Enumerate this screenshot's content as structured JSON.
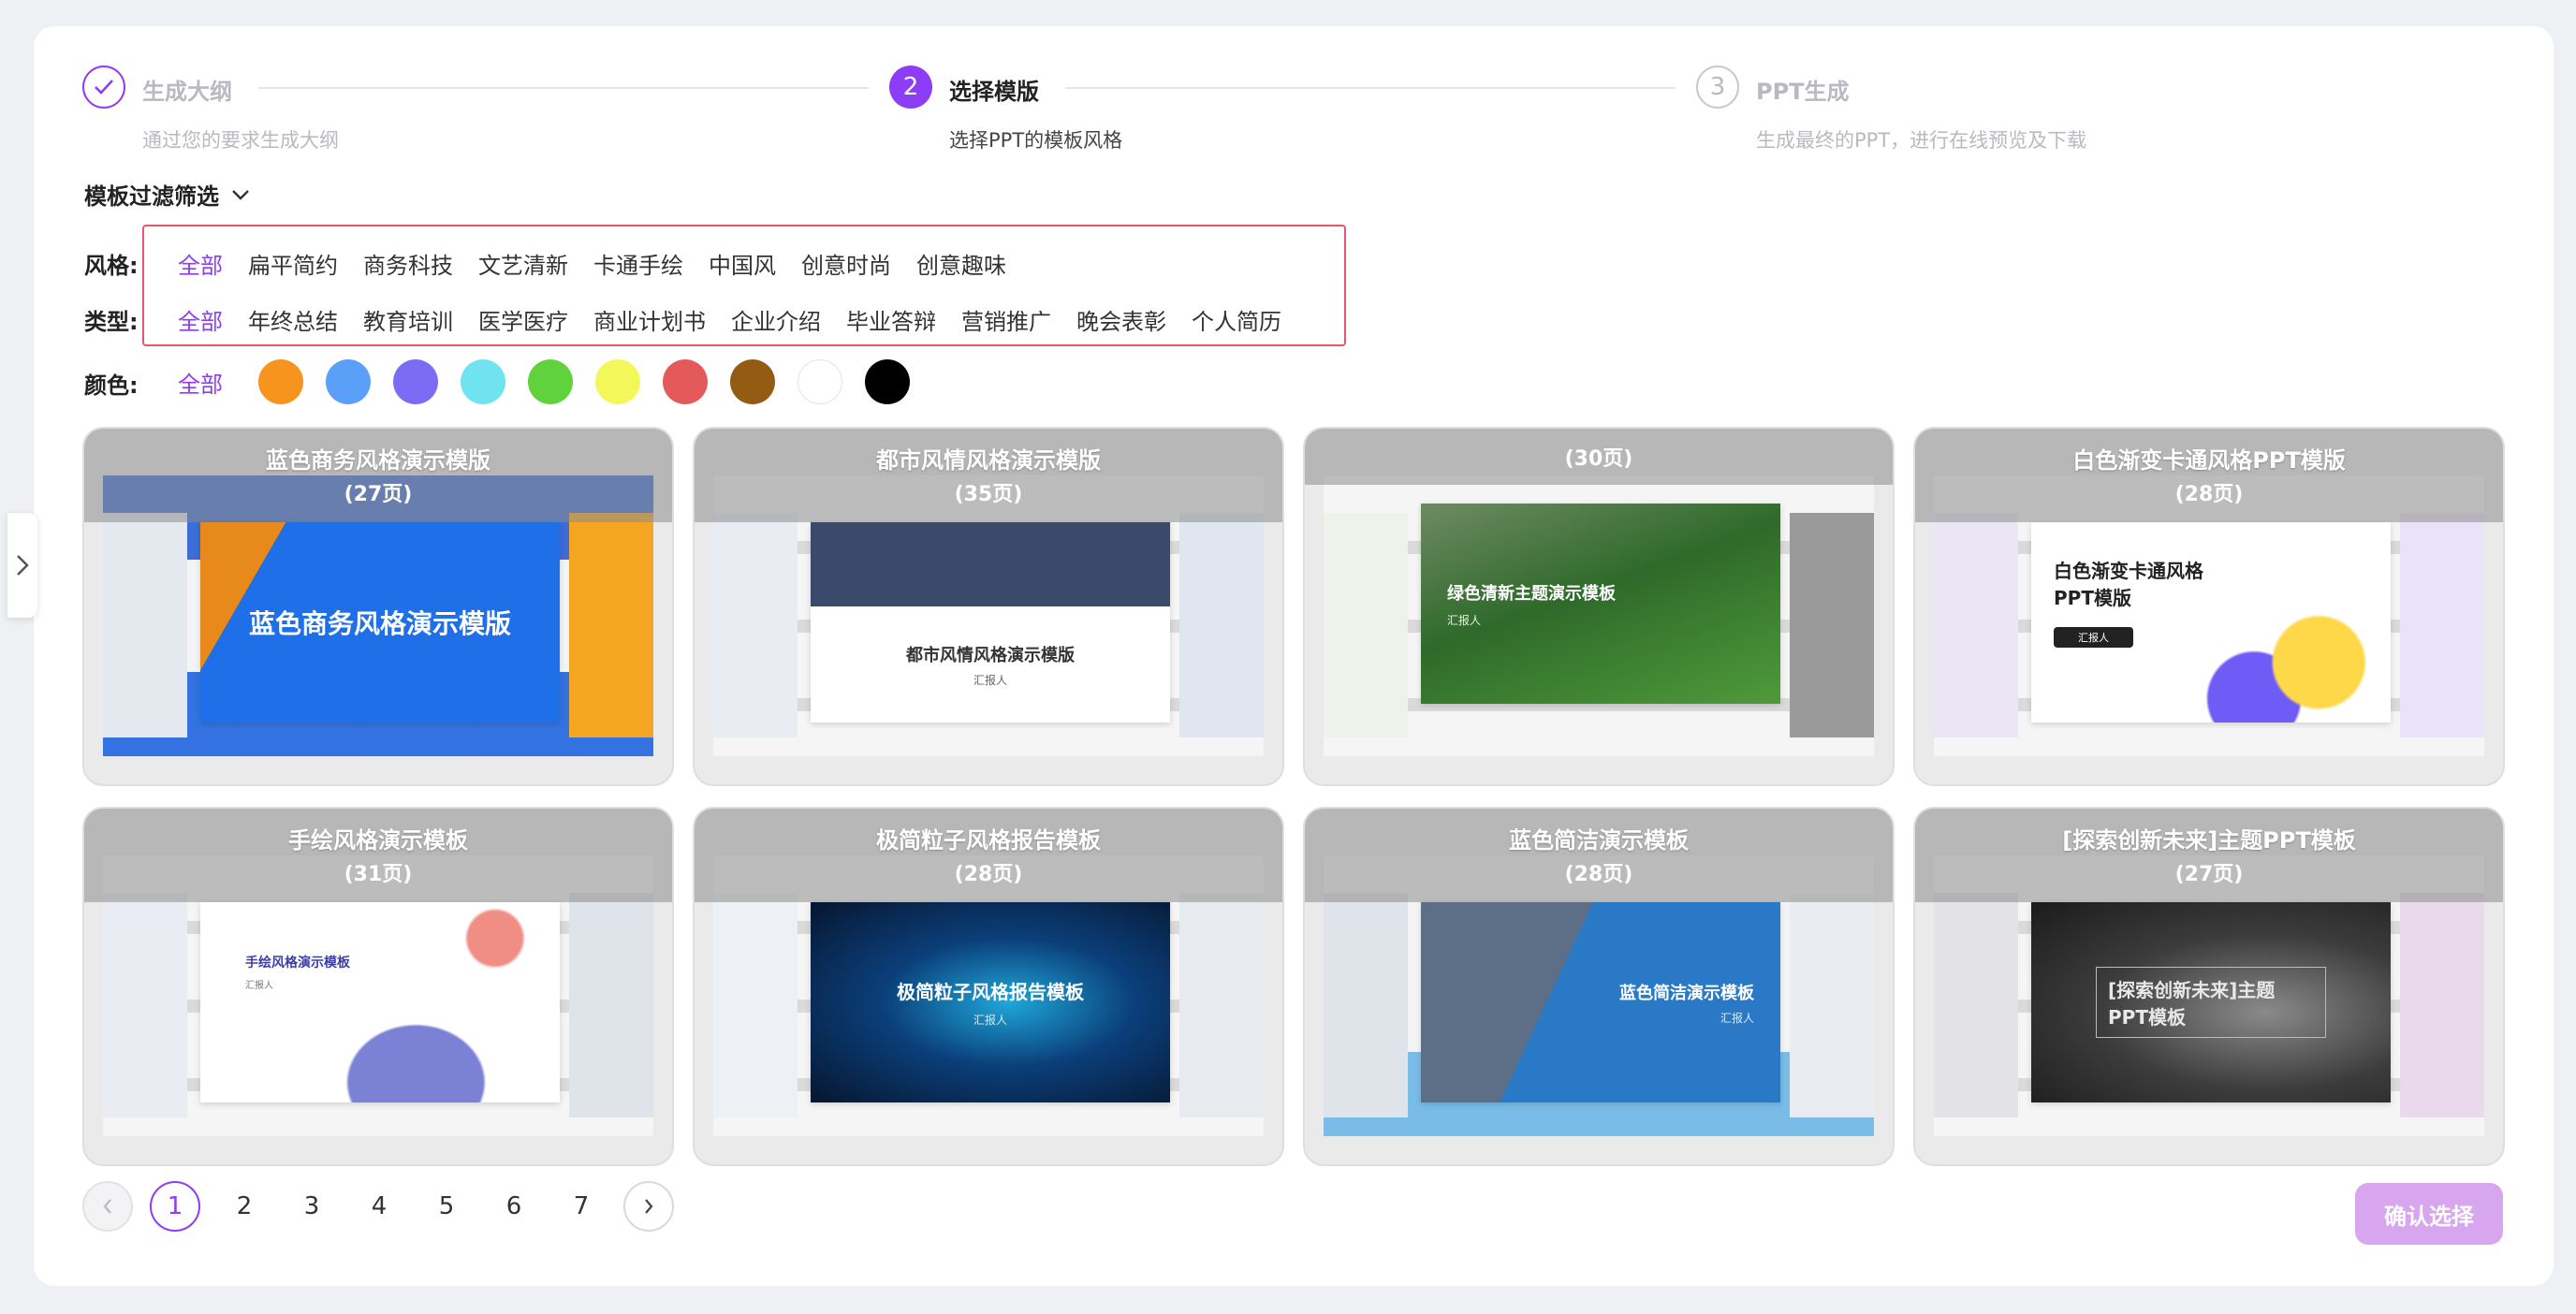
{
  "steps": [
    {
      "title": "生成大纲",
      "desc": "通过您的要求生成大纲",
      "state": "done"
    },
    {
      "number": "2",
      "title": "选择模版",
      "desc": "选择PPT的模板风格",
      "state": "active"
    },
    {
      "number": "3",
      "title": "PPT生成",
      "desc": "生成最终的PPT，进行在线预览及下载",
      "state": "pending"
    }
  ],
  "filter": {
    "heading": "模板过滤筛选",
    "style_label": "风格:",
    "style_options": [
      "全部",
      "扁平简约",
      "商务科技",
      "文艺清新",
      "卡通手绘",
      "中国风",
      "创意时尚",
      "创意趣味"
    ],
    "type_label": "类型:",
    "type_options": [
      "全部",
      "年终总结",
      "教育培训",
      "医学医疗",
      "商业计划书",
      "企业介绍",
      "毕业答辩",
      "营销推广",
      "晚会表彰",
      "个人简历"
    ],
    "color_label": "颜色:",
    "color_all": "全部",
    "colors": [
      "#f7941d",
      "#5aa0f8",
      "#7b6cf6",
      "#6fe3ef",
      "#5fd23c",
      "#f4f75a",
      "#e45a5a",
      "#945c12",
      "#ffffff",
      "#000000"
    ]
  },
  "templates": [
    {
      "name": "蓝色商务风格演示模版",
      "pages": "(27页)",
      "cover_title": "蓝色商务风格演示模版",
      "cover_sub": "",
      "theme": "blue-business"
    },
    {
      "name": "都市风情风格演示模版",
      "pages": "(35页)",
      "cover_title": "都市风情风格演示模版",
      "cover_sub": "汇报人",
      "theme": "city"
    },
    {
      "name": "",
      "pages": "(30页)",
      "cover_title": "绿色清新主题演示模板",
      "cover_sub": "汇报人",
      "theme": "green"
    },
    {
      "name": "白色渐变卡通风格PPT模版",
      "pages": "(28页)",
      "cover_title": "白色渐变卡通风格PPT模版",
      "cover_sub": "汇报人",
      "theme": "white-cartoon"
    },
    {
      "name": "手绘风格演示模板",
      "pages": "(31页)",
      "cover_title": "手绘风格演示模板",
      "cover_sub": "汇报人",
      "theme": "hand-drawn"
    },
    {
      "name": "极简粒子风格报告模板",
      "pages": "(28页)",
      "cover_title": "极简粒子风格报告模板",
      "cover_sub": "汇报人",
      "theme": "particle"
    },
    {
      "name": "蓝色简洁演示模板",
      "pages": "(28页)",
      "cover_title": "蓝色简洁演示模板",
      "cover_sub": "汇报人",
      "theme": "blue-simple"
    },
    {
      "name": "[探索创新未来]主题PPT模板",
      "pages": "(27页)",
      "cover_title": "[探索创新未来]主题PPT模板",
      "cover_sub": "",
      "theme": "space"
    }
  ],
  "pagination": {
    "pages": [
      "1",
      "2",
      "3",
      "4",
      "5",
      "6",
      "7"
    ],
    "current": "1"
  },
  "confirm_label": "确认选择",
  "accent": "#8d3df5"
}
